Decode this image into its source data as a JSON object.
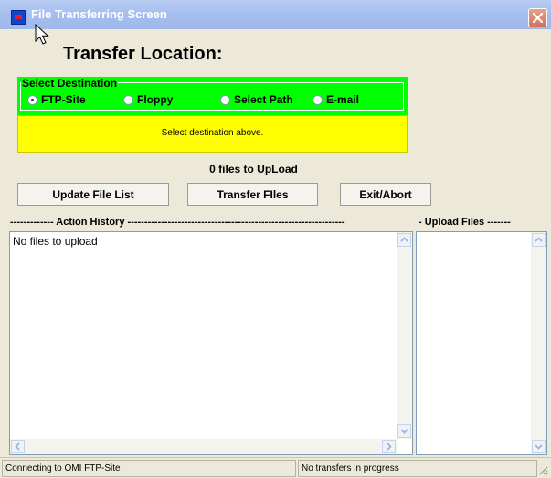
{
  "window": {
    "title": "File Transferring Screen"
  },
  "heading": "Transfer Location:",
  "destination": {
    "legend": "Select Destination",
    "options": [
      {
        "label": "FTP-Site",
        "checked": true
      },
      {
        "label": "Floppy",
        "checked": false
      },
      {
        "label": "Select Path",
        "checked": false
      },
      {
        "label": "E-mail",
        "checked": false
      }
    ]
  },
  "message": "Select destination above.",
  "files_count": "0 files to UpLoad",
  "buttons": {
    "update": "Update File List",
    "transfer": "Transfer FIles",
    "exit": "Exit/Abort"
  },
  "sections": {
    "action_history": "------------- Action History -----------------------------------------------------------------",
    "upload_files": "- Upload Files -------"
  },
  "action_history": {
    "text": "No files to upload"
  },
  "status": {
    "connection": "Connecting to OMI FTP-Site",
    "transfers": "No transfers in progress"
  },
  "colors": {
    "destination_bg": "#00ff00",
    "message_bg": "#ffff00",
    "titlebar": "#a7bfee",
    "close_button": "#d4715b"
  }
}
